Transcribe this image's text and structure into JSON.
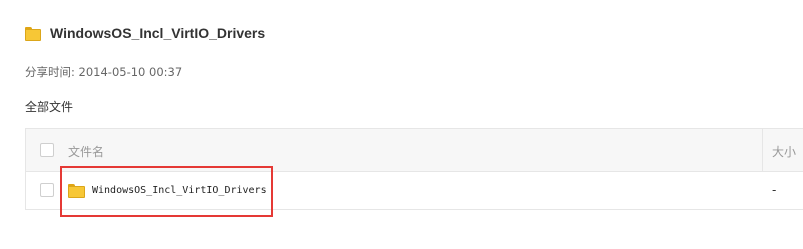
{
  "share": {
    "title": "WindowsOS_Incl_VirtIO_Drivers",
    "time_label": "分享时间:",
    "time_value": "2014-05-10 00:37"
  },
  "breadcrumb": {
    "all_files": "全部文件"
  },
  "table": {
    "columns": {
      "name": "文件名",
      "size": "大小"
    },
    "rows": [
      {
        "name": "WindowsOS_Incl_VirtIO_Drivers",
        "size": "-",
        "icon": "folder-icon"
      }
    ]
  },
  "colors": {
    "folder": "#f7c736",
    "highlight": "#e53935"
  }
}
